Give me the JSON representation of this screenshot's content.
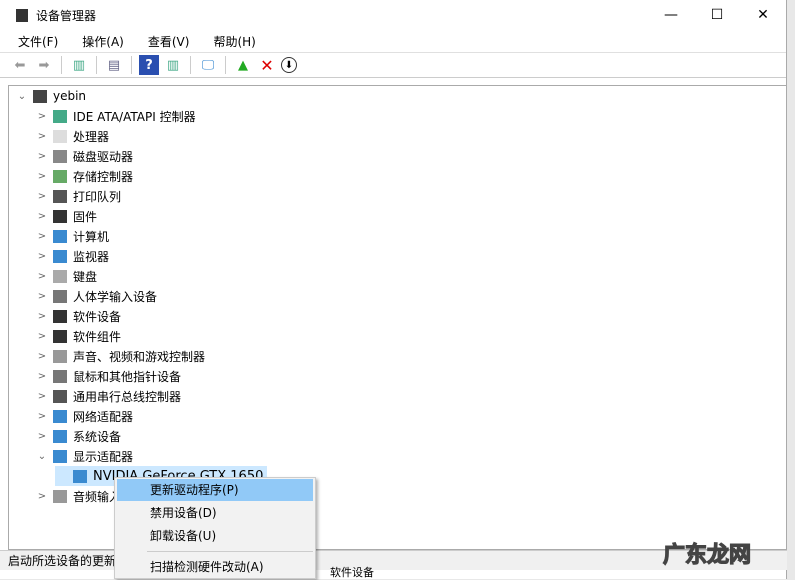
{
  "window": {
    "title": "设备管理器",
    "minimize": "—",
    "maximize": "☐",
    "close": "✕"
  },
  "menubar": [
    "文件(F)",
    "操作(A)",
    "查看(V)",
    "帮助(H)"
  ],
  "tree": {
    "root": "yebin",
    "categories": [
      "IDE ATA/ATAPI 控制器",
      "处理器",
      "磁盘驱动器",
      "存储控制器",
      "打印队列",
      "固件",
      "计算机",
      "监视器",
      "键盘",
      "人体学输入设备",
      "软件设备",
      "软件组件",
      "声音、视频和游戏控制器",
      "鼠标和其他指针设备",
      "通用串行总线控制器",
      "网络适配器",
      "系统设备",
      "显示适配器"
    ],
    "selected_device": "NVIDIA GeForce GTX 1650",
    "after": "音频输入和输出"
  },
  "context_menu": {
    "items": [
      "更新驱动程序(P)",
      "禁用设备(D)",
      "卸载设备(U)",
      "扫描检测硬件改动(A)"
    ]
  },
  "status": "启动所选设备的更新驱动程序向导。",
  "background_window_text": "软件设备",
  "watermark": "广东龙网"
}
